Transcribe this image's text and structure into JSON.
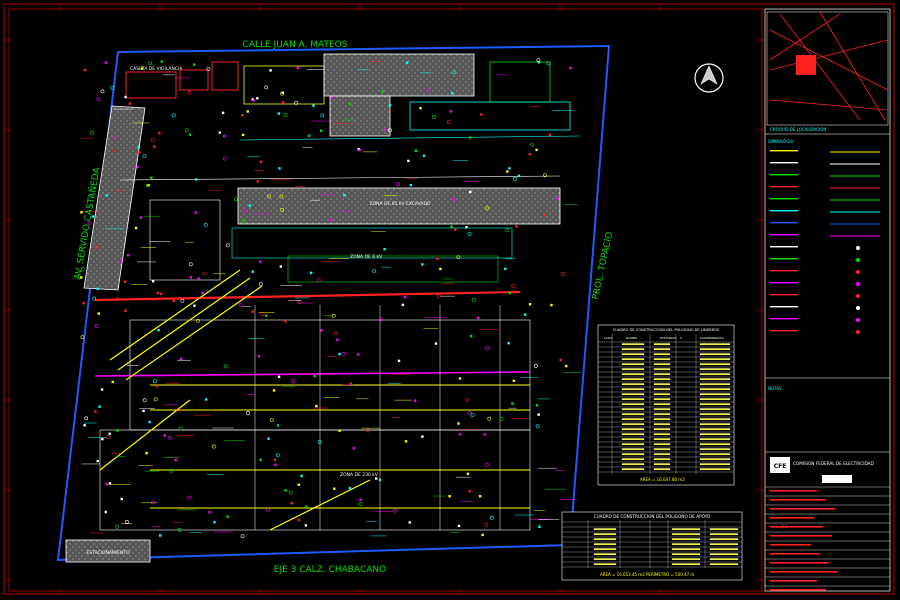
{
  "streets": {
    "north": "CALLE JUAN A. MATEOS",
    "west": "AV. SERVIDO CASTAÑEDA",
    "east": "PROL. TOPACIO",
    "south": "EJE 3 CALZ. CHABACANO"
  },
  "plan_labels": {
    "caseta": "CASETA DE VIGILANCIA",
    "zona_85kv": "ZONA DE 85 kV EXCAVADO",
    "zona_6kv": "ZONA DE 6 kV",
    "zona_230kv": "ZONA DE 230 kV",
    "estacionamiento": "ESTACIONAMIENTO"
  },
  "table_lindero": {
    "title": "CUADRO DE CONSTRUCCION DEL POLIGONO DE LINDEROS",
    "headers": [
      "LADO",
      "RUMBO",
      "DISTANCIA",
      "V",
      "COORDENADAS"
    ],
    "area": "AREA = 16,047.80 m2"
  },
  "table_apoyo": {
    "title": "CUADRO DE CONSTRUCCION DEL POLIGONO DE APOYO",
    "headers": [
      "LADO",
      "RUMBO",
      "DISTANCIA",
      "V",
      "COORDENADAS"
    ],
    "area": "AREA = 16,053.45 m2   PERIMETRO = 500.47 m"
  },
  "panel": {
    "location_title": "CROQUIS DE LOCALIZACION",
    "symbols_title": "SIMBOLOGIA",
    "notes_title": "NOTAS",
    "company": "COMISION FEDERAL DE ELECTRICIDAD",
    "logo_text": "CFE",
    "scale_value": "1:250"
  },
  "colors": {
    "boundary": "#1e5bff",
    "green": "#00e000",
    "red": "#ff2020",
    "magenta": "#ff00ff",
    "yellow": "#ffff00",
    "cyan": "#00ffff",
    "white": "#ffffff",
    "frame_red": "#c00000"
  },
  "icons": [
    "north-arrow-icon",
    "cfe-logo-icon"
  ]
}
